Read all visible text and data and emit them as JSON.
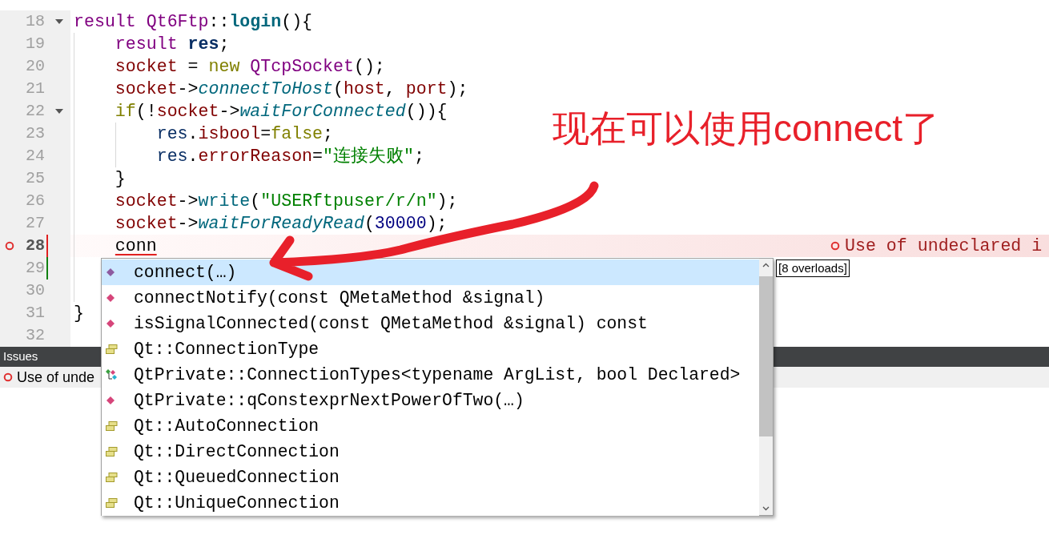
{
  "editor": {
    "lines": [
      {
        "number": "18",
        "foldable": true,
        "error": false,
        "modified": false,
        "saved": false,
        "tokens": [
          {
            "text": "result Qt6Ftp",
            "kind": "type"
          },
          {
            "text": "::",
            "kind": "plain"
          },
          {
            "text": "login",
            "kind": "function_decl"
          },
          {
            "text": "(){",
            "kind": "plain"
          }
        ]
      },
      {
        "number": "19",
        "foldable": false,
        "error": false,
        "modified": false,
        "saved": false,
        "tokens": [
          {
            "text": "    result ",
            "kind": "type"
          },
          {
            "text": "res",
            "kind": "local_decl"
          },
          {
            "text": ";",
            "kind": "plain"
          }
        ]
      },
      {
        "number": "20",
        "foldable": false,
        "error": false,
        "modified": false,
        "saved": false,
        "tokens": [
          {
            "text": "    socket",
            "kind": "member"
          },
          {
            "text": " = ",
            "kind": "plain"
          },
          {
            "text": "new ",
            "kind": "keyword"
          },
          {
            "text": "QTcpSocket",
            "kind": "type"
          },
          {
            "text": "();",
            "kind": "plain"
          }
        ]
      },
      {
        "number": "21",
        "foldable": false,
        "error": false,
        "modified": false,
        "saved": false,
        "tokens": [
          {
            "text": "    socket",
            "kind": "member"
          },
          {
            "text": "->",
            "kind": "plain"
          },
          {
            "text": "connectToHost",
            "kind": "virtual"
          },
          {
            "text": "(",
            "kind": "plain"
          },
          {
            "text": "host",
            "kind": "member"
          },
          {
            "text": ", ",
            "kind": "plain"
          },
          {
            "text": "port",
            "kind": "member"
          },
          {
            "text": ");",
            "kind": "plain"
          }
        ]
      },
      {
        "number": "22",
        "foldable": true,
        "error": false,
        "modified": false,
        "saved": false,
        "tokens": [
          {
            "text": "    if",
            "kind": "keyword"
          },
          {
            "text": "(!",
            "kind": "plain"
          },
          {
            "text": "socket",
            "kind": "member"
          },
          {
            "text": "->",
            "kind": "plain"
          },
          {
            "text": "waitForConnected",
            "kind": "virtual"
          },
          {
            "text": "()){",
            "kind": "plain"
          }
        ]
      },
      {
        "number": "23",
        "foldable": false,
        "error": false,
        "modified": false,
        "saved": false,
        "tokens": [
          {
            "text": "        res",
            "kind": "local"
          },
          {
            "text": ".",
            "kind": "plain"
          },
          {
            "text": "isbool",
            "kind": "member"
          },
          {
            "text": "=",
            "kind": "plain"
          },
          {
            "text": "false",
            "kind": "keyword"
          },
          {
            "text": ";",
            "kind": "plain"
          }
        ]
      },
      {
        "number": "24",
        "foldable": false,
        "error": false,
        "modified": false,
        "saved": false,
        "tokens": [
          {
            "text": "        res",
            "kind": "local"
          },
          {
            "text": ".",
            "kind": "plain"
          },
          {
            "text": "errorReason",
            "kind": "member"
          },
          {
            "text": "=",
            "kind": "plain"
          },
          {
            "text": "\"连接失败\"",
            "kind": "string"
          },
          {
            "text": ";",
            "kind": "plain"
          }
        ]
      },
      {
        "number": "25",
        "foldable": false,
        "error": false,
        "modified": false,
        "saved": false,
        "tokens": [
          {
            "text": "    }",
            "kind": "plain"
          }
        ]
      },
      {
        "number": "26",
        "foldable": false,
        "error": false,
        "modified": false,
        "saved": false,
        "tokens": [
          {
            "text": "    socket",
            "kind": "member"
          },
          {
            "text": "->",
            "kind": "plain"
          },
          {
            "text": "write",
            "kind": "method"
          },
          {
            "text": "(",
            "kind": "plain"
          },
          {
            "text": "\"USERftpuser/r/n\"",
            "kind": "string"
          },
          {
            "text": ");",
            "kind": "plain"
          }
        ]
      },
      {
        "number": "27",
        "foldable": false,
        "error": false,
        "modified": false,
        "saved": false,
        "tokens": [
          {
            "text": "    socket",
            "kind": "member"
          },
          {
            "text": "->",
            "kind": "plain"
          },
          {
            "text": "waitForReadyRead",
            "kind": "virtual"
          },
          {
            "text": "(",
            "kind": "plain"
          },
          {
            "text": "30000",
            "kind": "number"
          },
          {
            "text": ");",
            "kind": "plain"
          }
        ]
      },
      {
        "number": "28",
        "foldable": false,
        "error": true,
        "modified": true,
        "saved": false,
        "inline_error": "Use of undeclared i",
        "tokens": [
          {
            "text": "    conn",
            "kind": "error"
          }
        ]
      },
      {
        "number": "29",
        "foldable": false,
        "error": false,
        "modified": false,
        "saved": true
      },
      {
        "number": "30",
        "foldable": false,
        "error": false,
        "modified": false,
        "saved": false
      },
      {
        "number": "31",
        "foldable": false,
        "error": false,
        "modified": false,
        "saved": false,
        "tokens": [
          {
            "text": "}",
            "kind": "plain"
          }
        ]
      },
      {
        "number": "32",
        "foldable": false,
        "error": false,
        "modified": false,
        "saved": false
      }
    ]
  },
  "completion": {
    "items": [
      {
        "kind": "method",
        "label": "connect(…)",
        "selected": true
      },
      {
        "kind": "method",
        "label": "connectNotify(const QMetaMethod &signal)",
        "selected": false
      },
      {
        "kind": "method",
        "label": "isSignalConnected(const QMetaMethod &signal) const",
        "selected": false
      },
      {
        "kind": "enum",
        "label": "Qt::ConnectionType",
        "selected": false
      },
      {
        "kind": "template",
        "label": "QtPrivate::ConnectionTypes<typename ArgList, bool Declared>",
        "selected": false
      },
      {
        "kind": "method",
        "label": "QtPrivate::qConstexprNextPowerOfTwo(…)",
        "selected": false
      },
      {
        "kind": "enum",
        "label": "Qt::AutoConnection",
        "selected": false
      },
      {
        "kind": "enum",
        "label": "Qt::DirectConnection",
        "selected": false
      },
      {
        "kind": "enum",
        "label": "Qt::QueuedConnection",
        "selected": false
      },
      {
        "kind": "enum",
        "label": "Qt::UniqueConnection",
        "selected": false
      }
    ],
    "tooltip": "[8 overloads]"
  },
  "issues_panel": {
    "title": "Issues",
    "items": [
      {
        "text": "Use of unde"
      }
    ]
  },
  "annotation": {
    "text": "现在可以使用connect了"
  }
}
